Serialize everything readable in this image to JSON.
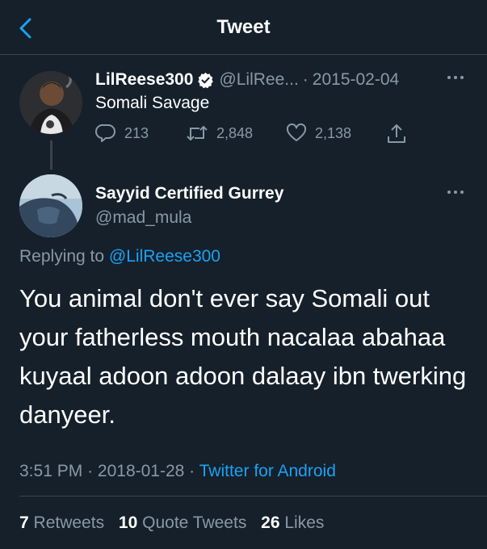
{
  "header": {
    "title": "Tweet"
  },
  "parent_tweet": {
    "name": "LilReese300",
    "handle": "@LilRee...",
    "separator": "·",
    "date": "2015-02-04",
    "text": "Somali Savage",
    "actions": {
      "replies": "213",
      "retweets": "2,848",
      "likes": "2,138"
    }
  },
  "main_tweet": {
    "name": "Sayyid Certified Gurrey",
    "handle": "@mad_mula",
    "replying_prefix": "Replying to",
    "replying_to": "@LilReese300",
    "text": "You animal don't ever say Somali out your fatherless mouth nacalaa abahaa kuyaal adoon adoon dalaay ibn twerking danyeer.",
    "time": "3:51 PM",
    "separator": "·",
    "date": "2018-01-28",
    "source": "Twitter for Android"
  },
  "stats": {
    "retweets_count": "7",
    "retweets_label": "Retweets",
    "quotes_count": "10",
    "quotes_label": "Quote Tweets",
    "likes_count": "26",
    "likes_label": "Likes"
  },
  "colors": {
    "background": "#15202b",
    "accent": "#1da1f2",
    "muted": "#8899a6",
    "divider": "#38444d"
  },
  "icons": [
    "back-arrow-icon",
    "verified-badge-icon",
    "more-icon",
    "reply-icon",
    "retweet-icon",
    "like-icon",
    "share-icon"
  ]
}
